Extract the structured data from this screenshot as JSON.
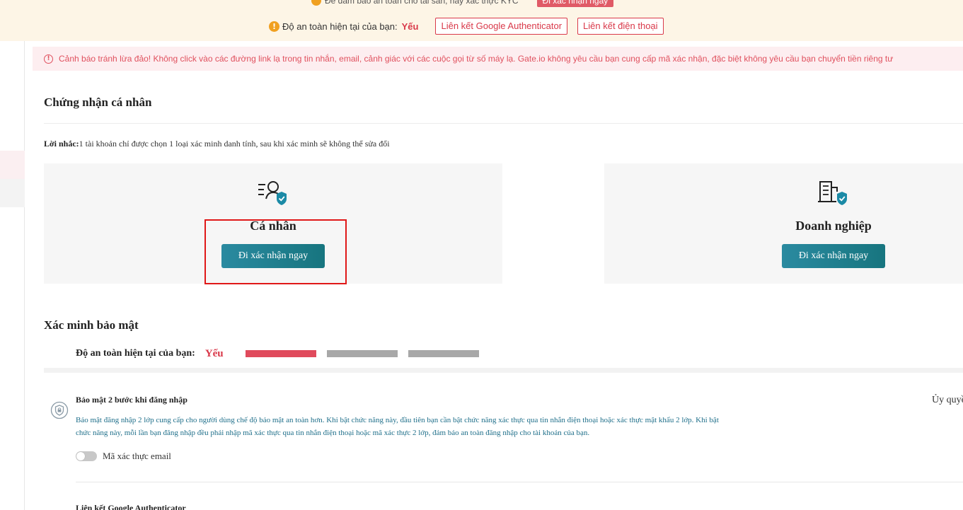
{
  "banner": {
    "line1_text": "Để đảm bảo an toàn cho tài sản, hãy xác thực KYC",
    "line1_button": "Đi xác nhận ngay",
    "safety_label": "Độ an toàn hiện tại của bạn:",
    "safety_level": "Yếu",
    "link_google": "Liên kết Google Authenticator",
    "link_phone": "Liên kết điện thoại",
    "warning_icon": "exclamation-icon"
  },
  "alert": {
    "icon": "alert-circle-icon",
    "text": "Cảnh báo tránh lừa đảo! Không click vào các đường link lạ trong tin nhắn, email, cảnh giác với các cuộc gọi từ số máy lạ. Gate.io không yêu cầu bạn cung cấp mã xác nhận, đặc biệt không yêu cầu bạn chuyển tiền riêng tư"
  },
  "identity": {
    "title": "Chứng nhận cá nhân",
    "reminder_label": "Lời nhắc:",
    "reminder_text": "1 tài khoản chỉ được chọn 1 loại xác minh danh tính, sau khi xác minh sẽ không thể sửa đổi",
    "cards": [
      {
        "title": "Cá nhân",
        "button": "Đi xác nhận ngay",
        "icon": "person-verified-icon"
      },
      {
        "title": "Doanh nghiệp",
        "button": "Đi xác nhận ngay",
        "icon": "building-verified-icon"
      }
    ]
  },
  "security": {
    "title": "Xác minh bảo mật",
    "level_label": "Độ an toàn hiện tại của bạn:",
    "level_value": "Yếu",
    "level_bars_filled": 1,
    "level_bars_total": 3,
    "items": [
      {
        "title": "Bảo mật 2 bước khi đăng nhập",
        "right_text": "Ủy quyề",
        "description": "Bảo mật đăng nhập 2 lớp cung cấp cho người dùng chế độ bảo mật an toàn hơn. Khi bật chức năng này, đầu tiên bạn cần bật chức năng xác thực qua tin nhắn điện thoại hoặc xác thực mật khẩu 2 lớp. Khi bật chức năng này, mỗi lần bạn đăng nhập đều phải nhập mã xác thực qua tin nhắn điện thoại hoặc mã xác thực 2 lớp, đảm bảo an toàn đăng nhập cho tài khoản của bạn.",
        "toggle_label": "Mã xác thực email",
        "toggle_on": false,
        "icon": "shield-lock-icon"
      },
      {
        "title": "Liên kết Google Authenticator"
      }
    ]
  },
  "colors": {
    "accent_red": "#d9394a",
    "button_teal": "#1f7f8f",
    "banner_bg": "#fdf5e6",
    "alert_bg": "#fdeef0",
    "bar_inactive": "#a8a8a8"
  }
}
